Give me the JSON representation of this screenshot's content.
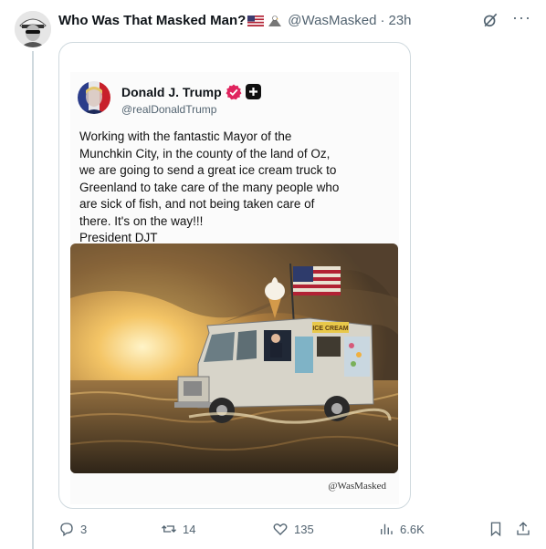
{
  "post": {
    "display_name": "Who Was That Masked Man?",
    "handle": "@WasMasked",
    "separator": "·",
    "time": "23h",
    "more_label": "···"
  },
  "quoted_screenshot": {
    "name": "Donald J. Trump",
    "handle": "@realDonaldTrump",
    "text": "Working with the fantastic Mayor of the\nMunchkin City, in the county of the land of Oz,\nwe are going to send a great ice cream truck  to\nGreenland to take care of the many people who\nare sick of fish, and not being taken care of\nthere. It's on the way!!!\nPresident DJT",
    "image_sign": "ICE CREAM",
    "watermark": "@WasMasked"
  },
  "actions": {
    "replies": "3",
    "reposts": "14",
    "likes": "135",
    "views": "6.6K"
  },
  "colors": {
    "text": "#0f1419",
    "muted": "#536471",
    "border": "#cfd9de",
    "verified_badge": "#e0245e"
  },
  "icons": [
    "grok-icon",
    "more-icon",
    "reply-icon",
    "repost-icon",
    "like-icon",
    "views-icon",
    "bookmark-icon",
    "share-icon"
  ]
}
